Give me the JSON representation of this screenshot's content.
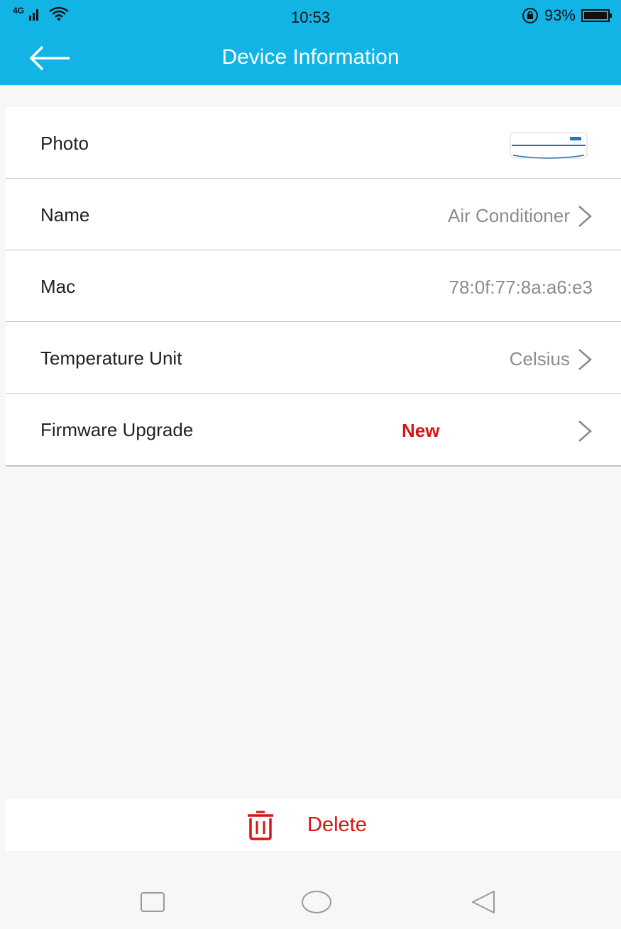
{
  "status_bar": {
    "network": "4G",
    "time": "10:53",
    "battery_percent": "93%"
  },
  "app_bar": {
    "title": "Device Information",
    "back_icon": "arrow-left-icon"
  },
  "rows": [
    {
      "label": "Photo",
      "thumbnail_icon": "air-conditioner-icon"
    },
    {
      "label": "Name",
      "value": "Air Conditioner",
      "chevron": true
    },
    {
      "label": "Mac",
      "value": "78:0f:77:8a:a6:e3",
      "chevron": false
    },
    {
      "label": "Temperature Unit",
      "value": "Celsius",
      "chevron": true
    },
    {
      "label": "Firmware Upgrade",
      "badge": "New",
      "chevron": true
    }
  ],
  "delete": {
    "label": "Delete",
    "icon": "trash-icon",
    "color": "#d81414"
  },
  "nav_bar": {
    "icons": [
      "recent-apps-icon",
      "home-icon",
      "back-icon"
    ]
  },
  "colors": {
    "primary": "#12b4e6",
    "badge": "#d81414",
    "value_text": "#8c8c8c"
  }
}
